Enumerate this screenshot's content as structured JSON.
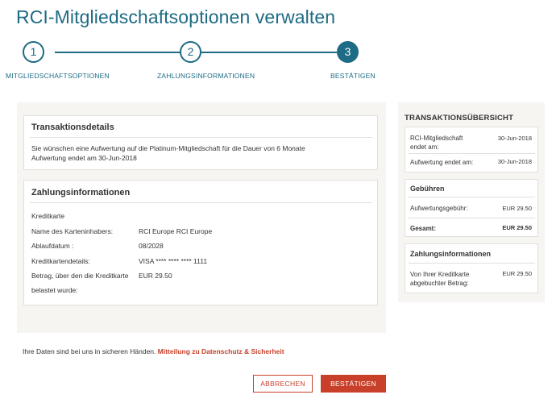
{
  "page": {
    "title": "RCI-Mitgliedschaftsoptionen verwalten"
  },
  "steps": [
    {
      "number": "1",
      "label": "MITGLIEDSCHAFTSOPTIONEN"
    },
    {
      "number": "2",
      "label": "ZAHLUNGSINFORMATIONEN"
    },
    {
      "number": "3",
      "label": "BESTÄTIGEN"
    }
  ],
  "transaction": {
    "title": "Transaktionsdetails",
    "line1": "Sie wünschen eine Aufwertung auf die Platinum-Mitgliedschaft für die Dauer von 6 Monate",
    "line2": "Aufwertung endet am  30-Jun-2018"
  },
  "payment": {
    "title": "Zahlungsinformationen",
    "method": "Kreditkarte",
    "rows": [
      {
        "label": "Name des Karteninhabers:",
        "value": "RCI Europe RCI Europe"
      },
      {
        "label": "Ablaufdatum :",
        "value": "08/2028"
      },
      {
        "label": "Kreditkartendetails:",
        "value": "VISA **** **** **** 1111"
      },
      {
        "label": "Betrag, über den die Kreditkarte",
        "label2": "belastet wurde:",
        "value": "EUR 29.50"
      }
    ]
  },
  "summary": {
    "heading": "TRANSAKTIONSÜBERSICHT",
    "membership_label_1": "RCI-Mitgliedschaft",
    "membership_label_2": "endet am:",
    "membership_value": "30-Jun-2018",
    "upgrade_label": "Aufwertung endet am:",
    "upgrade_value": "30-Jun-2018",
    "fees_title": "Gebühren",
    "fee_label": "Aufwertungsgebühr:",
    "fee_value": "EUR 29.50",
    "total_label": "Gesamt:",
    "total_value": "EUR 29.50",
    "payment_title": "Zahlungsinformationen",
    "charged_label_1": "Von Ihrer Kreditkarte",
    "charged_label_2": "abgebuchter Betrag:",
    "charged_value": "EUR 29.50"
  },
  "footer": {
    "text": "Ihre Daten sind bei uns in sicheren Händen.",
    "link": "Mitteilung zu Datenschutz & Sicherheit"
  },
  "buttons": {
    "cancel": "ABBRECHEN",
    "confirm": "BESTÄTIGEN"
  }
}
